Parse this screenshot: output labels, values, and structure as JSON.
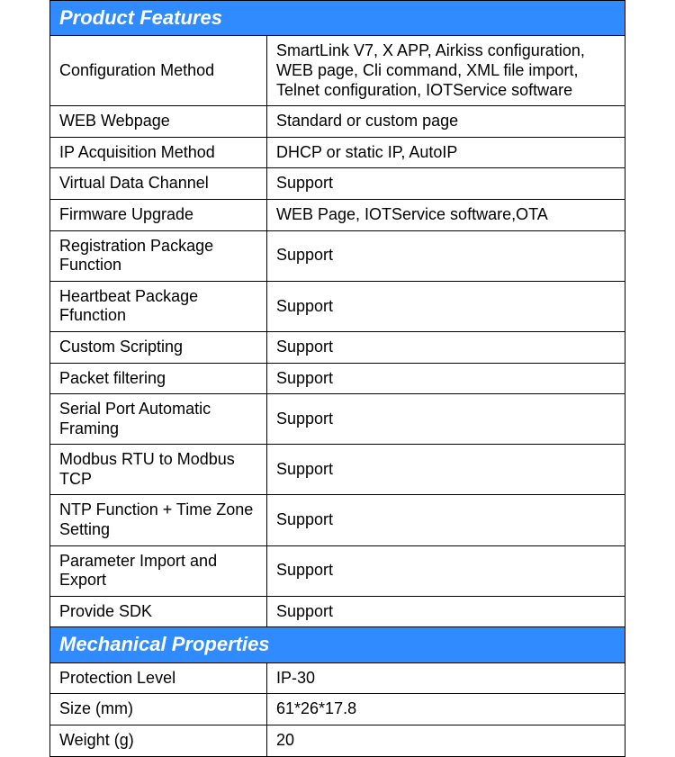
{
  "sections": [
    {
      "title": "Product Features",
      "rows": [
        {
          "label": "Configuration Method",
          "value": "SmartLink V7, X APP, Airkiss configuration, WEB page, Cli command, XML file import, Telnet configuration, IOTService software"
        },
        {
          "label": "WEB Webpage",
          "value": "Standard or custom page"
        },
        {
          "label": "IP Acquisition Method",
          "value": "DHCP or static IP, AutoIP"
        },
        {
          "label": "Virtual Data Channel",
          "value": "Support"
        },
        {
          "label": "Firmware Upgrade",
          "value": "WEB Page, IOTService software,OTA"
        },
        {
          "label": "Registration Package Function",
          "value": "Support"
        },
        {
          "label": "Heartbeat Package Ffunction",
          "value": "Support"
        },
        {
          "label": "Custom Scripting",
          "value": "Support"
        },
        {
          "label": "Packet filtering",
          "value": "Support"
        },
        {
          "label": "Serial Port Automatic Framing",
          "value": "Support"
        },
        {
          "label": "Modbus RTU to Modbus TCP",
          "value": "Support"
        },
        {
          "label": "NTP Function + Time Zone Setting",
          "value": "Support"
        },
        {
          "label": "Parameter Import and Export",
          "value": "Support"
        },
        {
          "label": "Provide SDK",
          "value": "Support"
        }
      ]
    },
    {
      "title": "Mechanical Properties",
      "rows": [
        {
          "label": "Protection Level",
          "value": "IP-30"
        },
        {
          "label": "Size (mm)",
          "value": "61*26*17.8"
        },
        {
          "label": "Weight (g)",
          "value": "20"
        }
      ]
    }
  ]
}
